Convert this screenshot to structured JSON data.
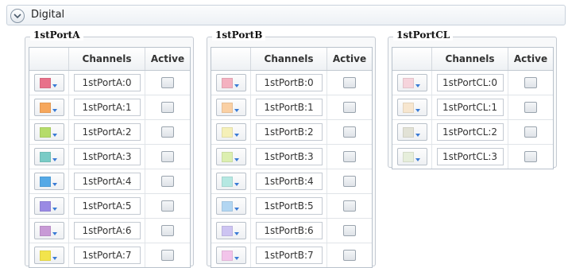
{
  "header": {
    "title": "Digital"
  },
  "columns": {
    "channels": "Channels",
    "active": "Active"
  },
  "ports": [
    {
      "title": "1stPortA",
      "rows": [
        {
          "label": "1stPortA:0",
          "color": "#e8718a",
          "active": false
        },
        {
          "label": "1stPortA:1",
          "color": "#f6a75c",
          "active": false
        },
        {
          "label": "1stPortA:2",
          "color": "#b5dc6a",
          "active": false
        },
        {
          "label": "1stPortA:3",
          "color": "#79cbc6",
          "active": false
        },
        {
          "label": "1stPortA:4",
          "color": "#55a9e6",
          "active": false
        },
        {
          "label": "1stPortA:5",
          "color": "#9a8ae4",
          "active": false
        },
        {
          "label": "1stPortA:6",
          "color": "#c89ad6",
          "active": false
        },
        {
          "label": "1stPortA:7",
          "color": "#f2e44c",
          "active": false
        }
      ]
    },
    {
      "title": "1stPortB",
      "rows": [
        {
          "label": "1stPortB:0",
          "color": "#f4b1c0",
          "active": false
        },
        {
          "label": "1stPortB:1",
          "color": "#fad0a4",
          "active": false
        },
        {
          "label": "1stPortB:2",
          "color": "#f5f0b8",
          "active": false
        },
        {
          "label": "1stPortB:3",
          "color": "#dcefb0",
          "active": false
        },
        {
          "label": "1stPortB:4",
          "color": "#b5e8e2",
          "active": false
        },
        {
          "label": "1stPortB:5",
          "color": "#b2d6f2",
          "active": false
        },
        {
          "label": "1stPortB:6",
          "color": "#cdc4f2",
          "active": false
        },
        {
          "label": "1stPortB:7",
          "color": "#f2c4ea",
          "active": false
        }
      ]
    },
    {
      "title": "1stPortCL",
      "rows": [
        {
          "label": "1stPortCL:0",
          "color": "#f6d4dc",
          "active": false
        },
        {
          "label": "1stPortCL:1",
          "color": "#f7e6cf",
          "active": false
        },
        {
          "label": "1stPortCL:2",
          "color": "#e2e2d6",
          "active": false
        },
        {
          "label": "1stPortCL:3",
          "color": "#e6eedb",
          "active": false
        }
      ]
    }
  ]
}
